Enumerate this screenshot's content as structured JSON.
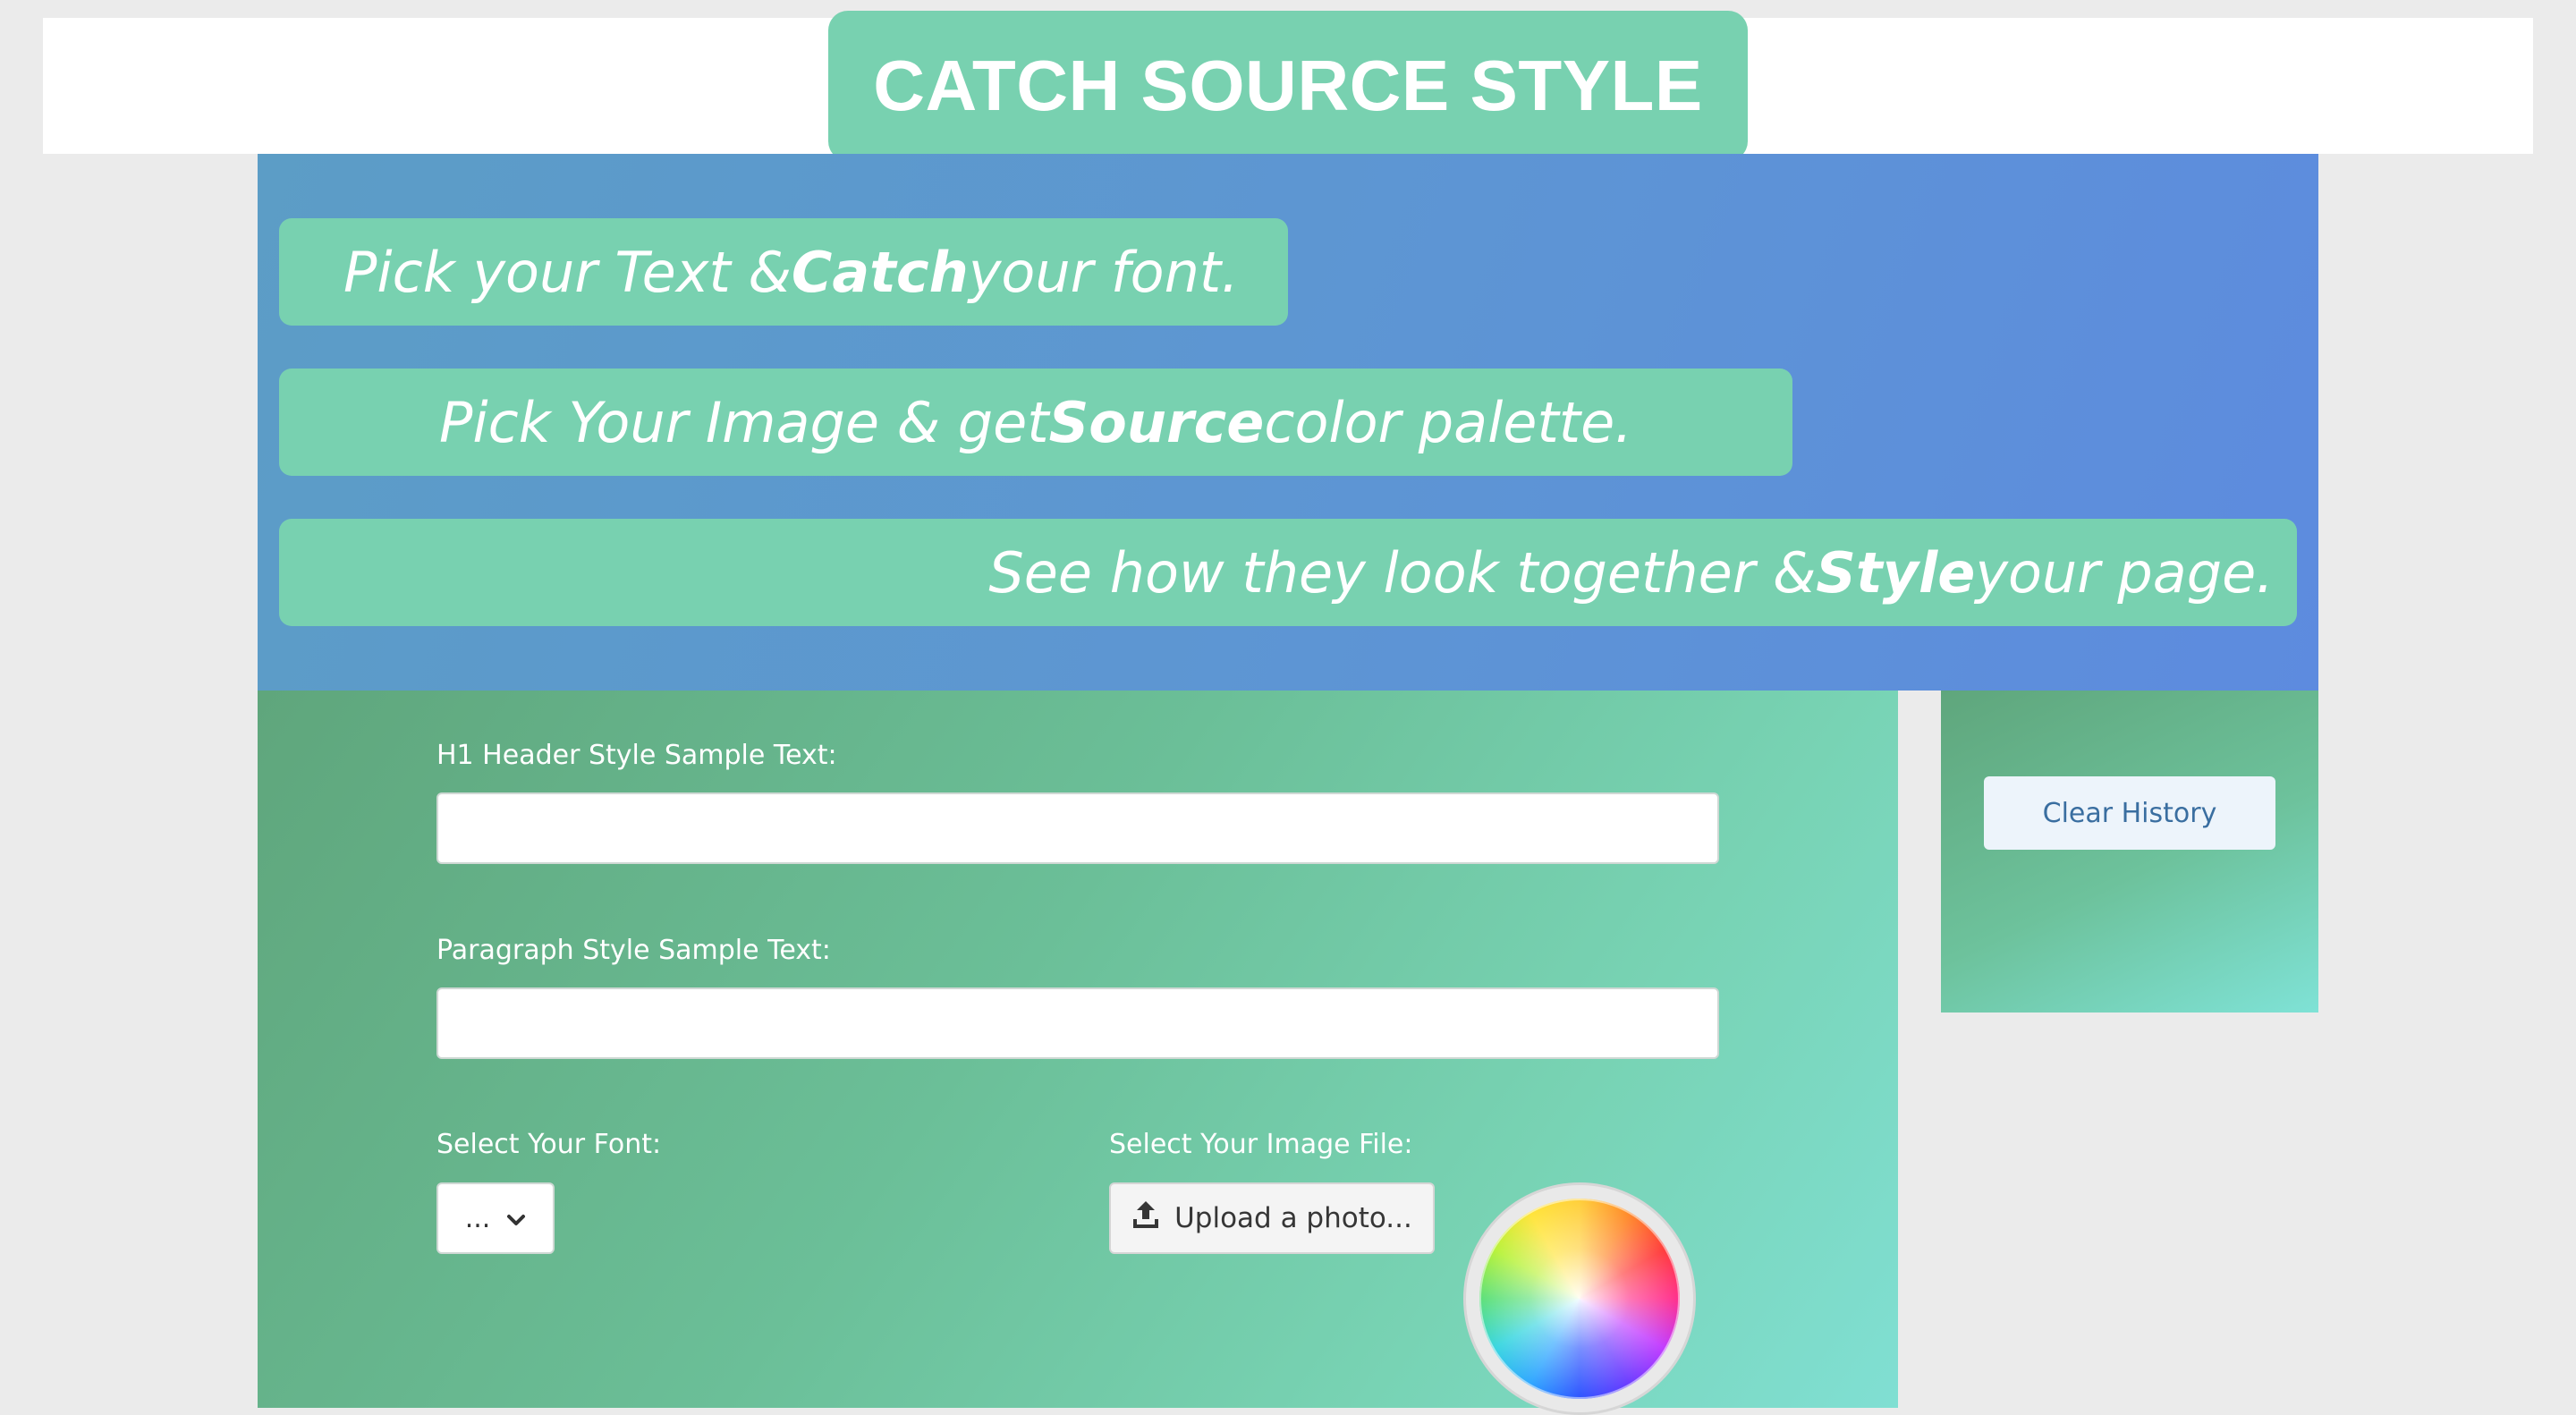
{
  "header": {
    "title": "CATCH SOURCE STYLE"
  },
  "hero": {
    "taglines": [
      {
        "before": "Pick your Text & ",
        "bold": "Catch",
        "after": " your font."
      },
      {
        "before": "Pick Your Image & get ",
        "bold": "Source",
        "after": " color palette."
      },
      {
        "before": "See how they look together & ",
        "bold": "Style",
        "after": " your page."
      }
    ]
  },
  "form": {
    "h1_label": "H1 Header Style Sample Text:",
    "h1_value": "",
    "paragraph_label": "Paragraph Style Sample Text:",
    "paragraph_value": "",
    "font_label": "Select Your Font:",
    "font_selected": "...",
    "image_label": "Select Your Image File:",
    "upload_label": "Upload a photo..."
  },
  "sidebar": {
    "clear_history_label": "Clear History"
  },
  "icons": {
    "upload": "upload-icon",
    "dropdown": "chevron-down-icon",
    "color_wheel": "color-wheel-icon"
  },
  "colors": {
    "accent_green": "#78d1b0",
    "hero_blue": "#5d95d4",
    "button_text": "#3a6ea0"
  }
}
